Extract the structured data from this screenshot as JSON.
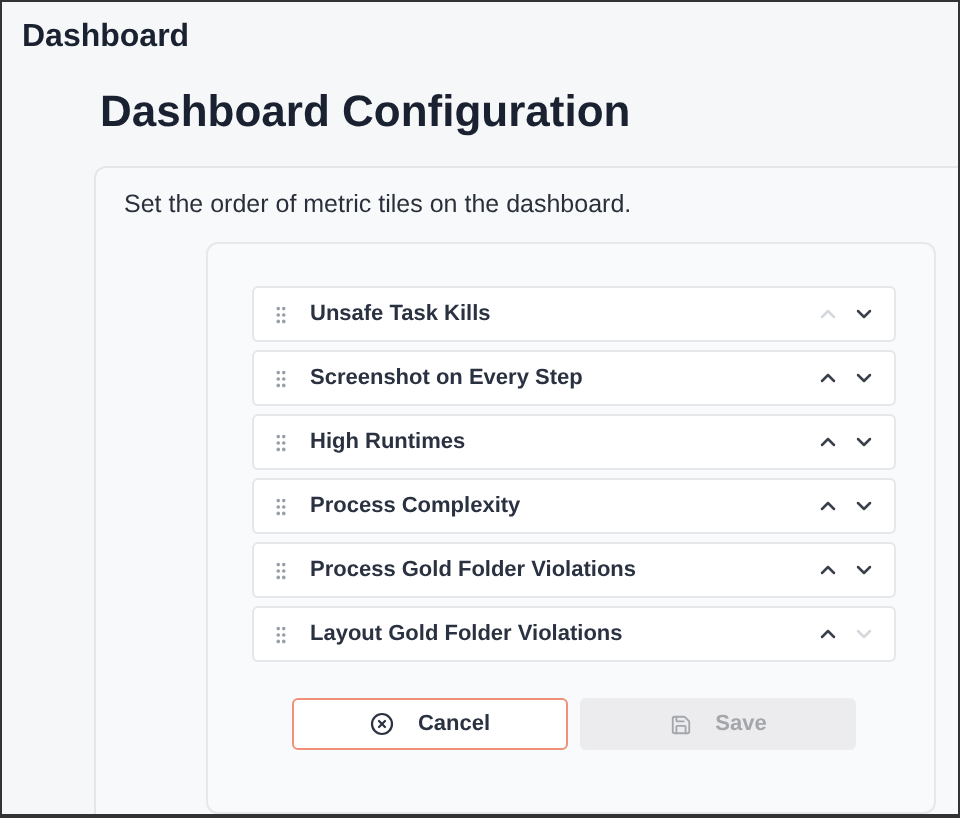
{
  "page_title": "Dashboard",
  "heading": "Dashboard Configuration",
  "description": "Set the order of metric tiles on the dashboard.",
  "tiles": [
    {
      "label": "Unsafe Task Kills",
      "up_disabled": true,
      "down_disabled": false
    },
    {
      "label": "Screenshot on Every Step",
      "up_disabled": false,
      "down_disabled": false
    },
    {
      "label": "High Runtimes",
      "up_disabled": false,
      "down_disabled": false
    },
    {
      "label": "Process Complexity",
      "up_disabled": false,
      "down_disabled": false
    },
    {
      "label": "Process Gold Folder Violations",
      "up_disabled": false,
      "down_disabled": false
    },
    {
      "label": "Layout Gold Folder Violations",
      "up_disabled": false,
      "down_disabled": true
    }
  ],
  "buttons": [
    {
      "kind": "cancel",
      "label": "Cancel",
      "disabled": false
    },
    {
      "kind": "save",
      "label": "Save",
      "disabled": true
    }
  ]
}
